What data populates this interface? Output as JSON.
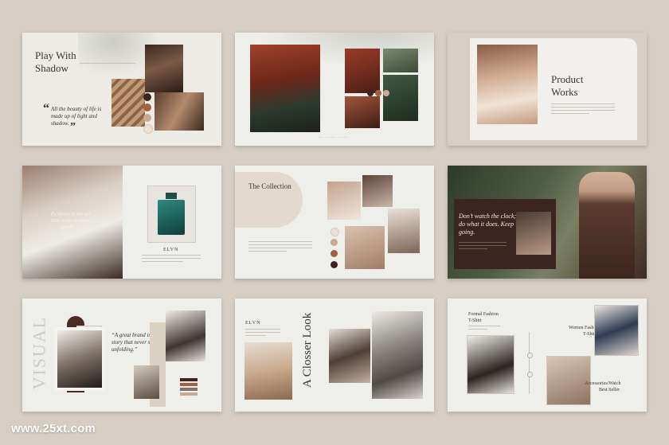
{
  "slides": {
    "s1": {
      "title_line1": "Play With",
      "title_line2": "Shadow",
      "quote_mark": "“",
      "quote_line1": "All the beauty of life is",
      "quote_line2": "made up of light and",
      "quote_line3": "shadow.",
      "quote_close": "”"
    },
    "s2": {
      "caption": "--- ------ -----"
    },
    "s3": {
      "title_line1": "Product",
      "title_line2": "Works"
    },
    "s4": {
      "overlay_line1": "Perfume is the art",
      "overlay_line2": "that make memory",
      "overlay_line3": "speak",
      "brand": "ELVN"
    },
    "s5": {
      "title": "The Collection"
    },
    "s6": {
      "quote_line1": "Don’t watch the clock;",
      "quote_line2": "do what it does. Keep",
      "quote_line3": "going."
    },
    "s7": {
      "side_word": "VISUAL",
      "quote_line1": "“A great brand is a",
      "quote_line2": "story that never stop",
      "quote_line3": "unfolding.”"
    },
    "s8": {
      "brand": "ELVN",
      "vertical_title": "A Closser Look"
    },
    "s9": {
      "label1_line1": "Formal Fashion",
      "label1_line2": "T-Shirt",
      "label2_line1": "Women Fashion",
      "label2_line2": "T-Shirt",
      "label3_line1": "Accessories/Watch",
      "label3_line2": "Best Seller"
    }
  },
  "palette": {
    "background": "#d6cec5",
    "slide": "#eeeeea",
    "dark_brown": "#3c2520",
    "rust": "#a3603f",
    "tan": "#c9a991",
    "cream": "#ede0d2",
    "text": "#3a3430"
  },
  "watermark": "www.25xt.com"
}
